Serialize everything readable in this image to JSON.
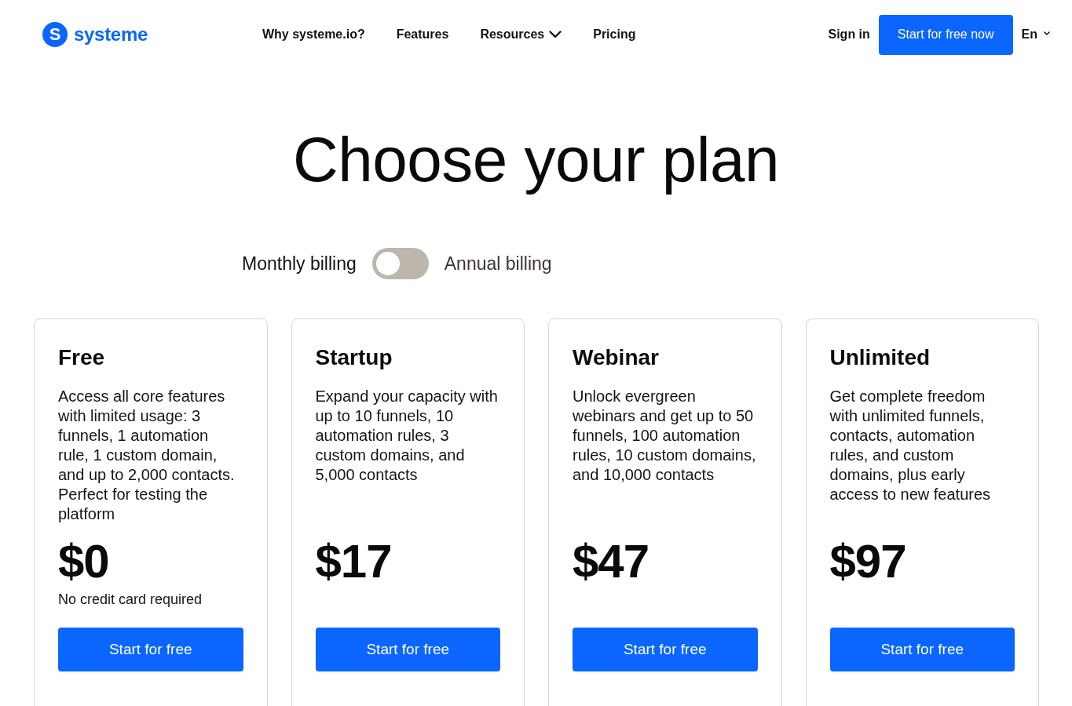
{
  "header": {
    "logo": {
      "mark": "S",
      "name": "systeme"
    },
    "nav": [
      {
        "label": "Why systeme.io?",
        "kind": "link"
      },
      {
        "label": "Features",
        "kind": "link"
      },
      {
        "label": "Resources",
        "kind": "dropdown"
      },
      {
        "label": "Pricing",
        "kind": "link"
      }
    ],
    "sign_in": "Sign in",
    "cta": "Start for free now",
    "language": "En"
  },
  "title": "Choose your plan",
  "billing": {
    "monthly_label": "Monthly billing",
    "annual_label": "Annual billing",
    "annual": false
  },
  "plans": [
    {
      "name": "Free",
      "description": "Access all core features with limited usage: 3 funnels, 1 automation rule, 1 custom domain, and up to 2,000 contacts. Perfect for testing the platform",
      "price": "$0",
      "note": "No credit card required",
      "button": "Start for free"
    },
    {
      "name": "Startup",
      "description": "Expand your capacity with up to 10 funnels, 10 automation rules, 3 custom domains, and 5,000 contacts",
      "price": "$17",
      "button": "Start for free"
    },
    {
      "name": "Webinar",
      "description": "Unlock evergreen webinars and get up to 50 funnels, 100 automation rules, 10 custom domains, and 10,000 contacts",
      "price": "$47",
      "button": "Start for free"
    },
    {
      "name": "Unlimited",
      "description": "Get complete freedom with unlimited funnels, contacts, automation rules, and custom domains, plus early access to new features",
      "price": "$97",
      "button": "Start for free"
    }
  ]
}
